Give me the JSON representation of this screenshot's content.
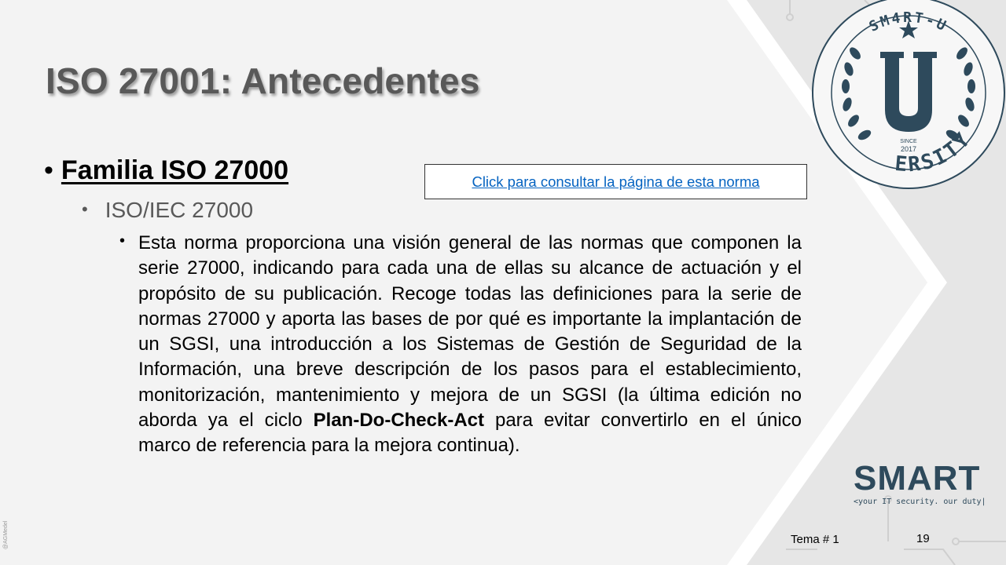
{
  "slide": {
    "title": "ISO 27001: Antecedentes",
    "bullet_level1": {
      "marker": "•",
      "text": "Familia ISO 27000"
    },
    "bullet_level2": {
      "marker": "•",
      "text": "ISO/IEC 27000"
    },
    "bullet_level3": {
      "marker": "•",
      "text_before_bold": "Esta norma proporciona una visión general de las normas que componen la serie 27000, indicando para cada una de ellas su alcance de actuación y el propósito de su publicación. Recoge todas las definiciones para la serie de normas 27000 y aporta las bases de por qué es importante la implantación de un SGSI, una introducción a los Sistemas de Gestión de Seguridad de la Información, una breve descripción de los pasos para el establecimiento, monitorización, mantenimiento y mejora de un SGSI (la última edición no aborda ya el ciclo ",
      "bold_text": "Plan-Do-Check-Act",
      "text_after_bold": " para evitar convertirlo en el único marco de referencia para la mejora continua)."
    },
    "link_label": "Click para consultar la página de esta norma"
  },
  "footer": {
    "topic": "Tema # 1",
    "page_number": "19",
    "credit": "@AGMedel"
  },
  "branding": {
    "smart_logo": {
      "text_before": "SM",
      "text_a": "A",
      "text_after": "RT",
      "tagline": "<your IT security. our duty|"
    },
    "badge": {
      "arc_top": "SM4RT-U",
      "letter": "U",
      "since_label": "SINCE",
      "year": "2017",
      "arc_bottom": "ERSITY"
    }
  },
  "colors": {
    "title_gray": "#595959",
    "link_blue": "#0563c1",
    "brand_navy": "#2e4a5c",
    "background": "#f2f2f2"
  }
}
